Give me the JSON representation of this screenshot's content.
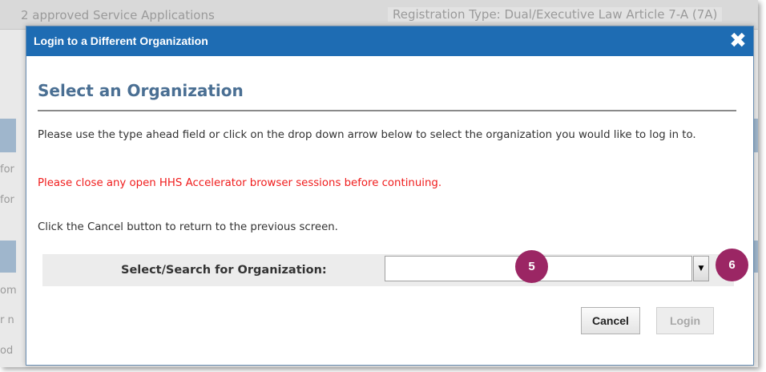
{
  "background": {
    "header_left": "2  approved Service Applications",
    "header_right": "Registration Type: Dual/Executive Law Article 7-A (7A)",
    "row_fragments": [
      "for",
      "for",
      "om",
      "r n",
      "od"
    ]
  },
  "modal": {
    "title": "Login to a Different Organization",
    "close_icon": "✖",
    "heading": "Select an Organization",
    "instruction": "Please use the type ahead field or click on the drop down arrow below to select the organization you would like to log in to.",
    "warning": "Please close any open HHS Accelerator browser sessions before continuing.",
    "cancel_info": "Click the Cancel button to return to the previous screen.",
    "org_field": {
      "label": "Select/Search for Organization:",
      "value": "",
      "dropdown_icon": "▼"
    },
    "callouts": [
      "5",
      "6"
    ],
    "buttons": {
      "cancel": "Cancel",
      "login": "Login"
    }
  },
  "colors": {
    "titlebar": "#1e6cb3",
    "heading": "#4a6f93",
    "warning": "#f01c1c",
    "callout": "#9b2664"
  }
}
